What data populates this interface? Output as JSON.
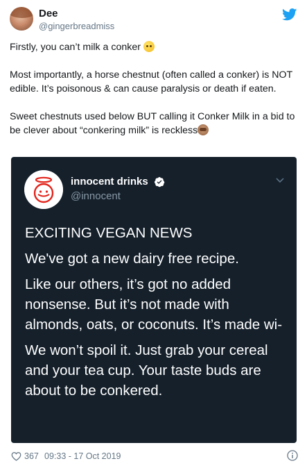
{
  "author": {
    "name": "Dee",
    "handle": "@gingerbreadmiss"
  },
  "tweet": {
    "paragraph1": "Firstly, you can’t milk a conker ",
    "paragraph2": "Most importantly, a horse chestnut (often called a conker) is NOT edible. It’s poisonous & can cause paralysis or death if eaten.",
    "paragraph3": "Sweet chestnuts used below BUT calling it Conker Milk in a bid to be clever about “conkering milk” is reckless"
  },
  "quoted": {
    "name": "innocent drinks",
    "handle": "@innocent",
    "line1": "EXCITING VEGAN NEWS",
    "line2": "We've got a new dairy free recipe.",
    "line3": "Like our others, it’s got no added nonsense. But it’s not made with almonds, oats, or coconuts. It’s made wi-",
    "line4": "We won’t spoil it. Just grab your cereal and your tea cup. Your taste buds are about to be conkered."
  },
  "footer": {
    "likes": "367",
    "timestamp": "09:33 - 17 Oct 2019"
  },
  "icons": {
    "bird": "twitter-bird-icon",
    "verified": "verified-badge-icon",
    "heart": "heart-icon",
    "info": "info-icon",
    "chevron": "chevron-down-icon"
  },
  "colors": {
    "brand_blue": "#1da1f2",
    "embed_bg": "#15202b",
    "muted": "#657786",
    "innocent_red": "#e2231a"
  }
}
